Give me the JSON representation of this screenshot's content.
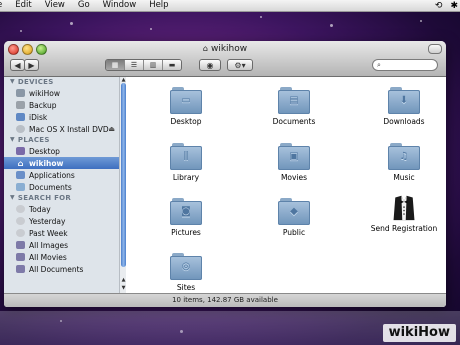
{
  "menubar": {
    "items": [
      "e",
      "Edit",
      "View",
      "Go",
      "Window",
      "Help"
    ]
  },
  "window": {
    "title": "wikihow"
  },
  "sidebar": {
    "devices_header": "DEVICES",
    "devices": [
      {
        "label": "wikiHow",
        "icon": "computer-icon"
      },
      {
        "label": "Backup",
        "icon": "drive-icon"
      },
      {
        "label": "iDisk",
        "icon": "idisk-icon"
      },
      {
        "label": "Mac OS X Install DVD",
        "icon": "dvd-icon"
      }
    ],
    "places_header": "PLACES",
    "places": [
      {
        "label": "Desktop",
        "icon": "desktop-icon"
      },
      {
        "label": "wikihow",
        "icon": "home-icon",
        "selected": true
      },
      {
        "label": "Applications",
        "icon": "applications-icon"
      },
      {
        "label": "Documents",
        "icon": "documents-icon"
      }
    ],
    "search_header": "SEARCH FOR",
    "searches": [
      {
        "label": "Today",
        "icon": "clock-icon"
      },
      {
        "label": "Yesterday",
        "icon": "clock-icon"
      },
      {
        "label": "Past Week",
        "icon": "clock-icon"
      },
      {
        "label": "All Images",
        "icon": "smart-folder-icon"
      },
      {
        "label": "All Movies",
        "icon": "smart-folder-icon"
      },
      {
        "label": "All Documents",
        "icon": "smart-folder-icon"
      }
    ]
  },
  "files": [
    {
      "label": "Desktop",
      "icon": "desktop-folder-icon"
    },
    {
      "label": "Documents",
      "icon": "documents-folder-icon"
    },
    {
      "label": "Downloads",
      "icon": "downloads-folder-icon"
    },
    {
      "label": "Library",
      "icon": "library-folder-icon"
    },
    {
      "label": "Movies",
      "icon": "movies-folder-icon"
    },
    {
      "label": "Music",
      "icon": "music-folder-icon"
    },
    {
      "label": "Pictures",
      "icon": "pictures-folder-icon"
    },
    {
      "label": "Public",
      "icon": "public-folder-icon"
    },
    {
      "label": "Send Registration",
      "icon": "tuxedo-icon"
    },
    {
      "label": "Sites",
      "icon": "sites-folder-icon"
    }
  ],
  "status": {
    "text": "10 items, 142.87 GB available"
  },
  "watermark": {
    "wiki": "wiki",
    "how": "How"
  },
  "colors": {
    "selection": "#3e6fc0",
    "folder": "#8aaed2",
    "sidebar_bg": "#dee4ea"
  }
}
